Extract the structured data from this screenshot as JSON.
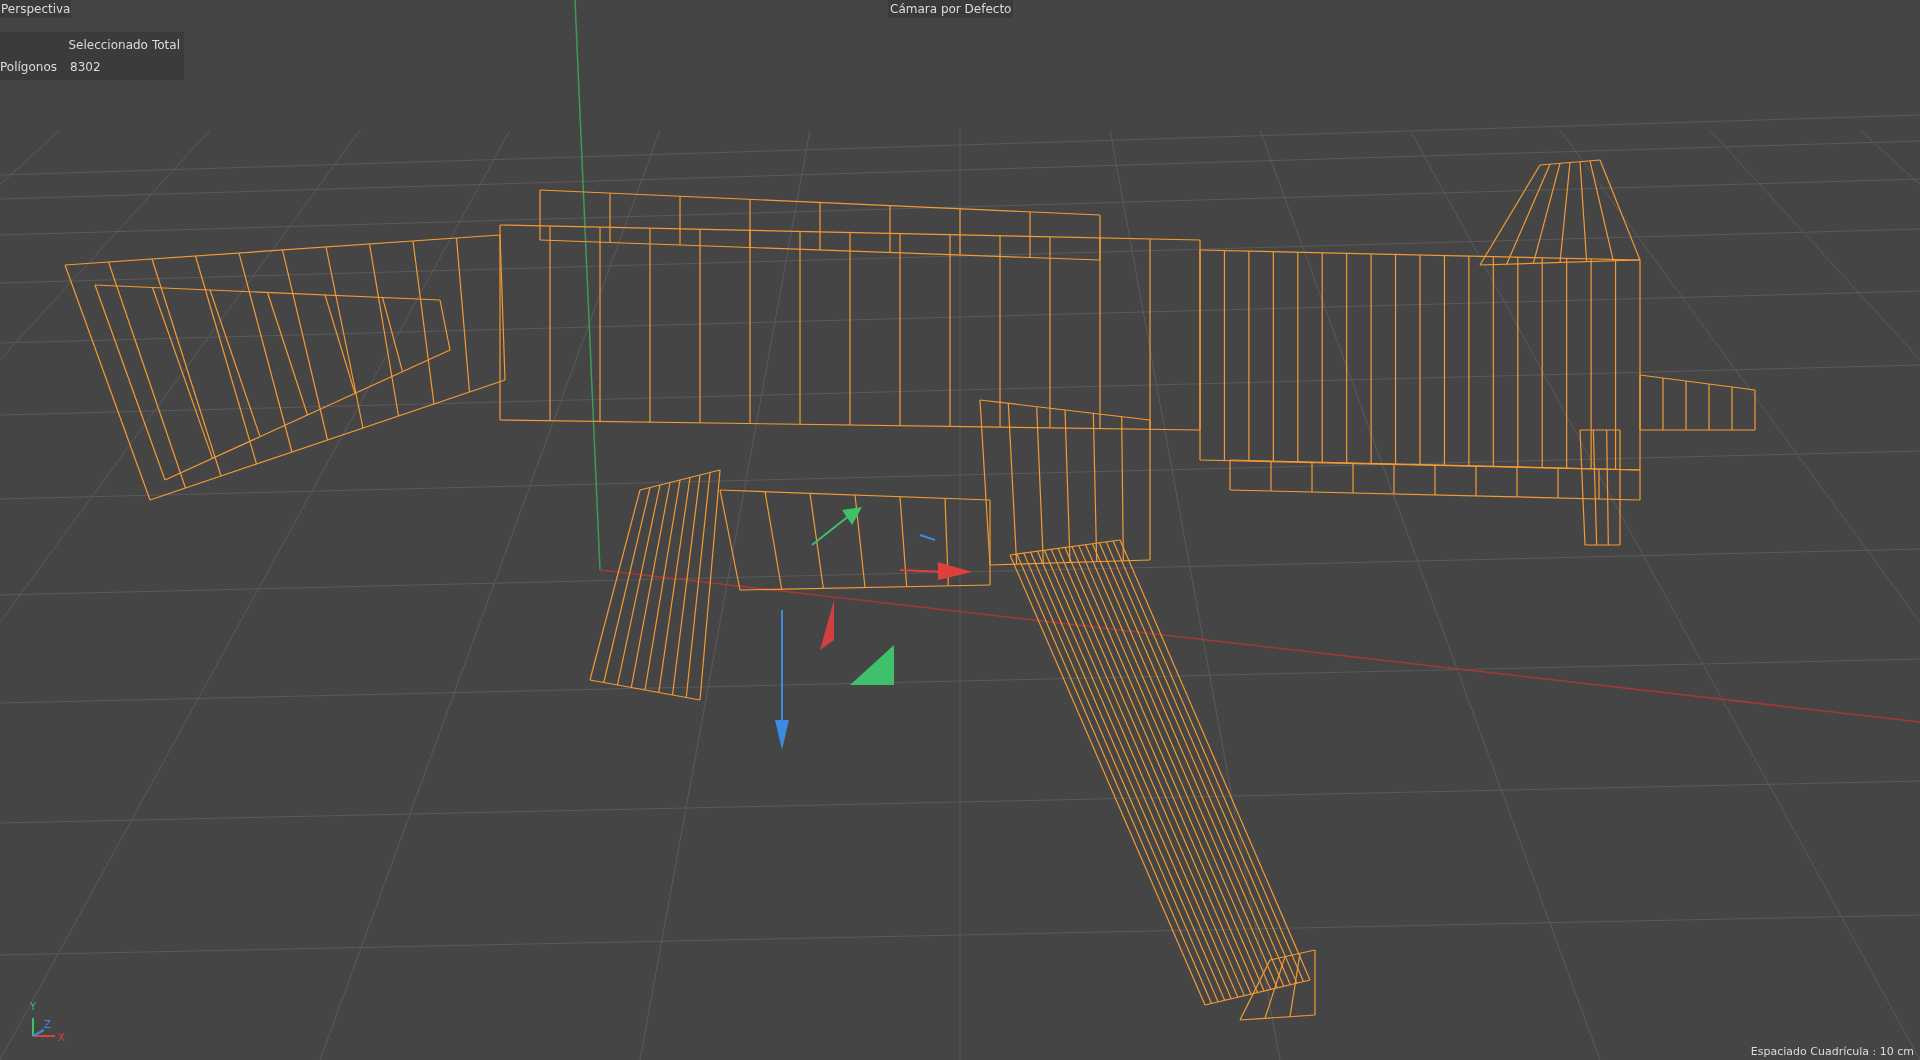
{
  "viewport": {
    "view_name": "Perspectiva",
    "camera": "Cámara por Defecto",
    "stats": {
      "columns": [
        "Seleccionado",
        "Total"
      ],
      "rows": [
        {
          "label": "Polígonos",
          "values": [
            "8302"
          ]
        }
      ]
    },
    "axis_labels": [
      "Y",
      "Z",
      "X"
    ],
    "grid_spacing": "Espaciado Cuadrícula : 10 cm"
  }
}
